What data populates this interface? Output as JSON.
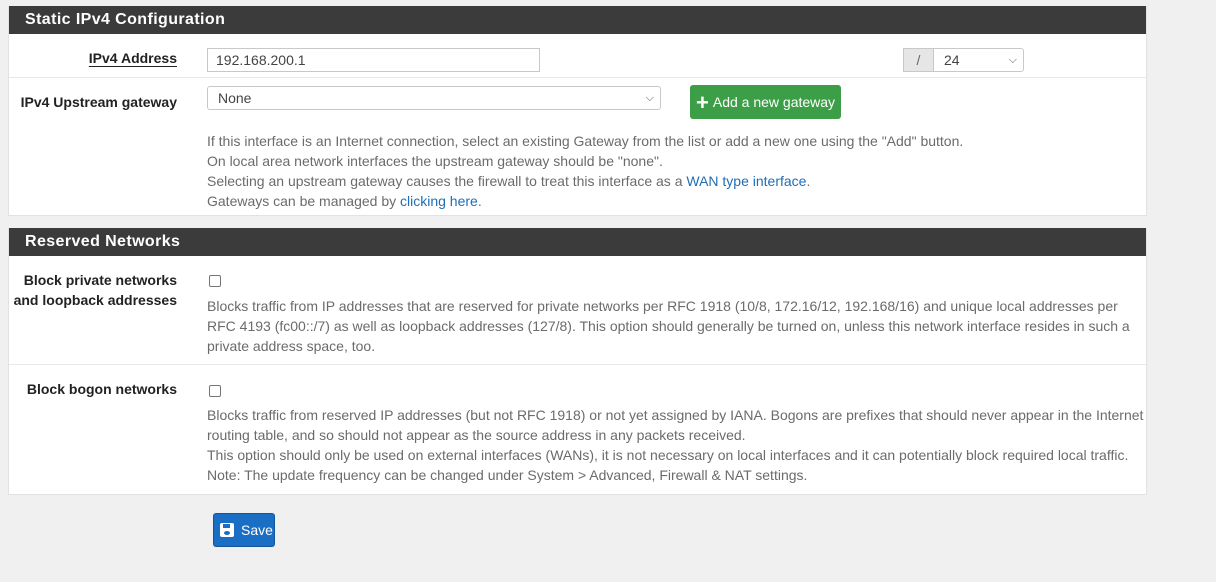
{
  "static_ipv4": {
    "heading": "Static IPv4 Configuration",
    "ipv4_address": {
      "label": "IPv4 Address",
      "value": "192.168.200.1",
      "separator": "/",
      "prefix": "24"
    },
    "gateway": {
      "label": "IPv4 Upstream gateway",
      "selected": "None",
      "add_button": "Add a new gateway",
      "help_line1": "If this interface is an Internet connection, select an existing Gateway from the list or add a new one using the \"Add\" button.",
      "help_line2": "On local area network interfaces the upstream gateway should be \"none\".",
      "help_line3_pre": "Selecting an upstream gateway causes the firewall to treat this interface as a ",
      "help_line3_link": "WAN type interface",
      "help_line3_post": ".",
      "help_line4_pre": "Gateways can be managed by ",
      "help_line4_link": "clicking here",
      "help_line4_post": "."
    }
  },
  "reserved_networks": {
    "heading": "Reserved Networks",
    "block_private": {
      "label_line1": "Block private networks",
      "label_line2": "and loopback addresses",
      "help_line1": "Blocks traffic from IP addresses that are reserved for private networks per RFC 1918 (10/8, 172.16/12, 192.168/16) and unique local addresses per",
      "help_line2": "RFC 4193 (fc00::/7) as well as loopback addresses (127/8). This option should generally be turned on, unless this network interface resides in such a",
      "help_line3": "private address space, too."
    },
    "block_bogon": {
      "label": "Block bogon networks",
      "help_line1": "Blocks traffic from reserved IP addresses (but not RFC 1918) or not yet assigned by IANA. Bogons are prefixes that should never appear in the Internet",
      "help_line2": "routing table, and so should not appear as the source address in any packets received.",
      "help_line3": "This option should only be used on external interfaces (WANs), it is not necessary on local interfaces and it can potentially block required local traffic.",
      "help_line4": "Note: The update frequency can be changed under System > Advanced, Firewall & NAT settings."
    }
  },
  "save_button": "Save"
}
